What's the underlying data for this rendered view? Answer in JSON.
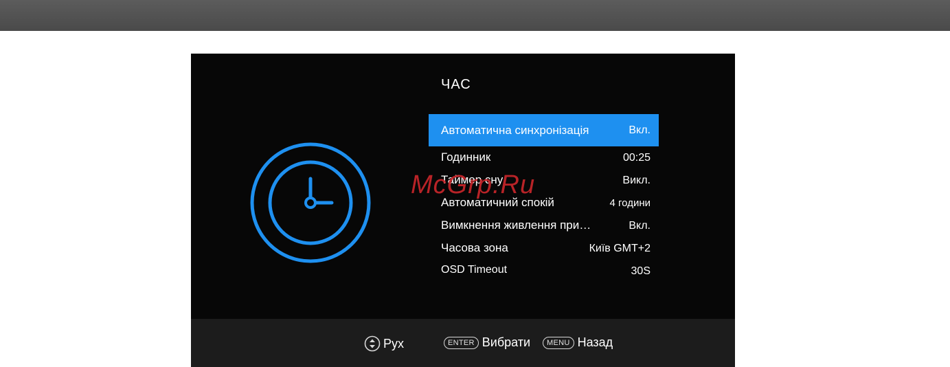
{
  "screen": {
    "title": "ЧАС",
    "accent_color": "#1e90f0",
    "icon": "clock-icon",
    "items": [
      {
        "label": "Автоматична синхронізація",
        "value": "Вкл.",
        "selected": true
      },
      {
        "label": "Годинник",
        "value": "00:25"
      },
      {
        "label": "Таймер сну",
        "value": "Викл."
      },
      {
        "label": "Автоматичний спокій",
        "value": "4 години"
      },
      {
        "label": "Вимкнення живлення при…",
        "value": "Вкл."
      },
      {
        "label": "Часова зона",
        "value": "Київ GMT+2"
      },
      {
        "label": "OSD Timeout",
        "value": "30S"
      }
    ]
  },
  "footer": {
    "move_icon": "up-down-arrows-icon",
    "move_label": "Рух",
    "enter_key": "ENTER",
    "select_label": "Вибрати",
    "menu_key": "MENU",
    "back_label": "Назад"
  },
  "watermark": "McGrp.Ru"
}
